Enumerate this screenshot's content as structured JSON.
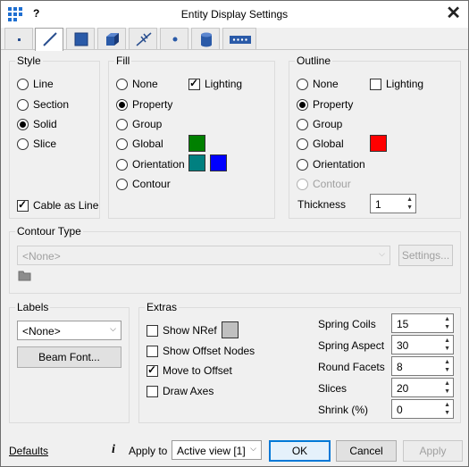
{
  "window": {
    "title": "Entity Display Settings",
    "help": "?",
    "close": "✕"
  },
  "tabs": [
    {
      "icon": "dot-icon"
    },
    {
      "icon": "line-icon",
      "active": true
    },
    {
      "icon": "solid-square-icon"
    },
    {
      "icon": "cube-icon"
    },
    {
      "icon": "spring-icon"
    },
    {
      "icon": "point-icon"
    },
    {
      "icon": "cylinder-icon"
    },
    {
      "icon": "dotted-bar-icon"
    }
  ],
  "style": {
    "label": "Style",
    "options": [
      "Line",
      "Section",
      "Solid",
      "Slice"
    ],
    "selected": "Solid",
    "cable_as_line": "Cable as Line"
  },
  "fill": {
    "label": "Fill",
    "options": [
      "None",
      "Property",
      "Group",
      "Global",
      "Orientation",
      "Contour"
    ],
    "selected": "Property",
    "lighting": "Lighting",
    "colors": {
      "global": "#008000",
      "orientation_1": "#008080",
      "orientation_2": "#0000ff"
    }
  },
  "outline": {
    "label": "Outline",
    "options": [
      "None",
      "Property",
      "Group",
      "Global",
      "Orientation",
      "Contour"
    ],
    "selected": "Property",
    "lighting": "Lighting",
    "colors": {
      "global": "#ff0000"
    },
    "thickness_label": "Thickness",
    "thickness_value": "1"
  },
  "contour_type": {
    "label": "Contour Type",
    "value": "<None>",
    "settings_button": "Settings..."
  },
  "labels": {
    "label": "Labels",
    "value": "<None>",
    "beam_font_button": "Beam Font..."
  },
  "extras": {
    "label": "Extras",
    "checks": [
      {
        "label": "Show NRef",
        "checked": false
      },
      {
        "label": "Show Offset Nodes",
        "checked": false
      },
      {
        "label": "Move to Offset",
        "checked": true
      },
      {
        "label": "Draw Axes",
        "checked": false
      }
    ],
    "nref_color": "#c0c0c0",
    "fields": [
      {
        "label": "Spring Coils",
        "value": "15"
      },
      {
        "label": "Spring Aspect",
        "value": "30"
      },
      {
        "label": "Round Facets",
        "value": "8"
      },
      {
        "label": "Slices",
        "value": "20"
      },
      {
        "label": "Shrink (%)",
        "value": "0"
      }
    ]
  },
  "footer": {
    "defaults": "Defaults",
    "info": "i",
    "apply_to_label": "Apply to",
    "apply_to_value": "Active view [1]",
    "ok": "OK",
    "cancel": "Cancel",
    "apply": "Apply"
  }
}
